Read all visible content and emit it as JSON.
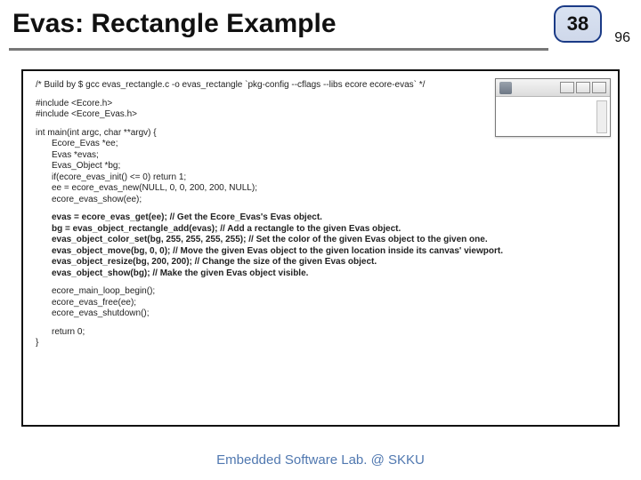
{
  "header": {
    "title": "Evas: Rectangle Example",
    "page_number": "38",
    "total_pages": "96"
  },
  "code": {
    "build_comment": "/* Build by $ gcc evas_rectangle.c -o evas_rectangle `pkg-config --cflags --libs ecore ecore-evas` */",
    "inc1": "#include <Ecore.h>",
    "inc2": "#include <Ecore_Evas.h>",
    "fn_sig": "int main(int argc, char **argv) {",
    "decl1": "Ecore_Evas *ee;",
    "decl2": "Evas *evas;",
    "decl3": "Evas_Object *bg;",
    "decl4": "if(ecore_evas_init() <= 0) return 1;",
    "decl5": "ee = ecore_evas_new(NULL, 0, 0, 200, 200, NULL);",
    "decl6": "ecore_evas_show(ee);",
    "b1": "evas = ecore_evas_get(ee); // Get the Ecore_Evas's Evas object.",
    "b2": "bg = evas_object_rectangle_add(evas); // Add a rectangle to the given Evas object.",
    "b3": "evas_object_color_set(bg, 255, 255, 255, 255); // Set the color of the given Evas object to the given one.",
    "b4": "evas_object_move(bg, 0, 0); // Move the given Evas object to the given location inside its canvas' viewport.",
    "b5": "evas_object_resize(bg, 200, 200); // Change the size of the given Evas object.",
    "b6": "evas_object_show(bg); // Make the given Evas object visible.",
    "e1": "ecore_main_loop_begin();",
    "e2": "ecore_evas_free(ee);",
    "e3": "ecore_evas_shutdown();",
    "ret": "return 0;",
    "close": "}"
  },
  "footer": {
    "text": "Embedded Software Lab. @ SKKU"
  }
}
